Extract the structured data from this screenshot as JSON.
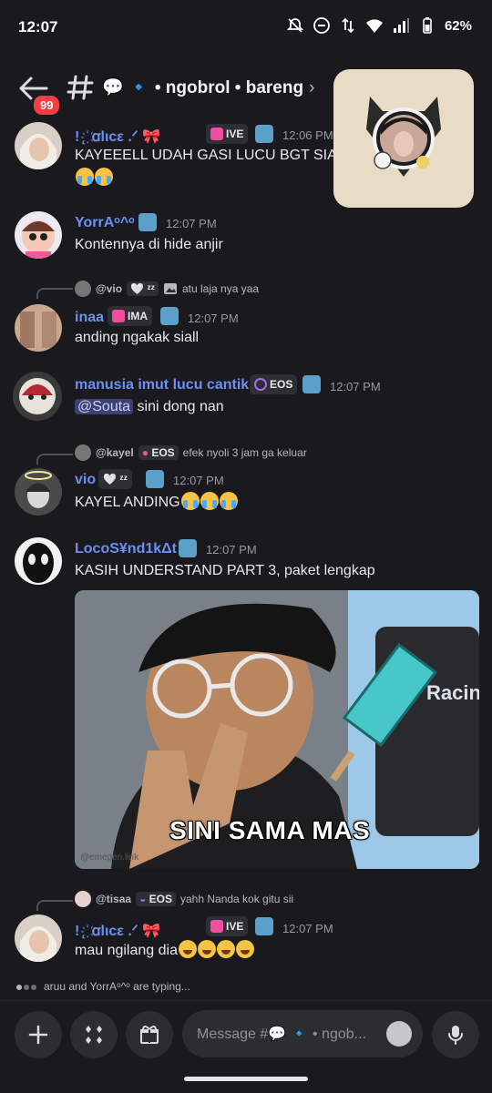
{
  "status_bar": {
    "time": "12:07",
    "battery": "62%"
  },
  "header": {
    "back_badge": "99",
    "channel_name": "💬 🔹 • ngobrol • bareng",
    "chevron": "›"
  },
  "messages": [
    {
      "username": "!  ̨ ҉ ꭤlιcε .ᐟ 🎀",
      "role_tag": "IVE",
      "time": "12:06 PM",
      "text": "KAYEEELL UDAH GASI LUCU BGT SIA",
      "emoji": "😭😭"
    },
    {
      "username": "YorrAᵒ^ᵒ",
      "time": "12:07 PM",
      "text": "Kontennya di hide anjir"
    },
    {
      "reply": {
        "name": "@vio",
        "tag": "🤍 ᶻᶻ",
        "text": "atu laja nya yaa",
        "has_image_icon": true
      },
      "username": "inaa",
      "role_tag": "IMA",
      "time": "12:07 PM",
      "text": "anding ngakak siall"
    },
    {
      "username": "manusia imut lucu cantik",
      "role_tag": "EOS",
      "time": "12:07 PM",
      "mention": "@Souta",
      "text": "sini dong nan"
    },
    {
      "reply": {
        "name": "@kayel",
        "tag": "EOS",
        "text": "efek nyoli 3 jam ga keluar"
      },
      "username": "vio",
      "role_tag": "🤍 ᶻᶻ",
      "time": "12:07 PM",
      "text": "KAYEL ANDING",
      "emoji": "😭😭😭"
    },
    {
      "username": "LocoS¥nd1kΔt",
      "time": "12:07 PM",
      "text": "KASIH UNDERSTAND PART 3, paket lengkap",
      "image": {
        "caption": "SINI SAMA MAS",
        "watermark": "@emegen.link",
        "sign_text": "Racin Fer"
      }
    },
    {
      "reply": {
        "name": "@tisaa",
        "tag": "EOS",
        "text": "yahh Nanda kok gitu sii"
      },
      "username": "!  ̨ ҉ ꭤlιcε .ᐟ 🎀",
      "role_tag": "IVE",
      "time": "12:07 PM",
      "text": "mau ngilang dia",
      "emoji": "🤣🤣🤣🤣"
    }
  ],
  "typing": {
    "text": "aruu and YorrAᵒ^ᵒ are typing..."
  },
  "composer": {
    "placeholder": "Message #💬 🔹 • ngob..."
  },
  "icons": [
    "back-arrow-icon",
    "hash-icon",
    "plus-icon",
    "apps-icon",
    "gift-icon",
    "emoji-icon",
    "microphone-icon",
    "image-icon"
  ],
  "colors": {
    "background": "#1a1a1e",
    "username": "#6d8ff2",
    "badge": "#f23f43",
    "mention_bg": "#3c4270"
  }
}
